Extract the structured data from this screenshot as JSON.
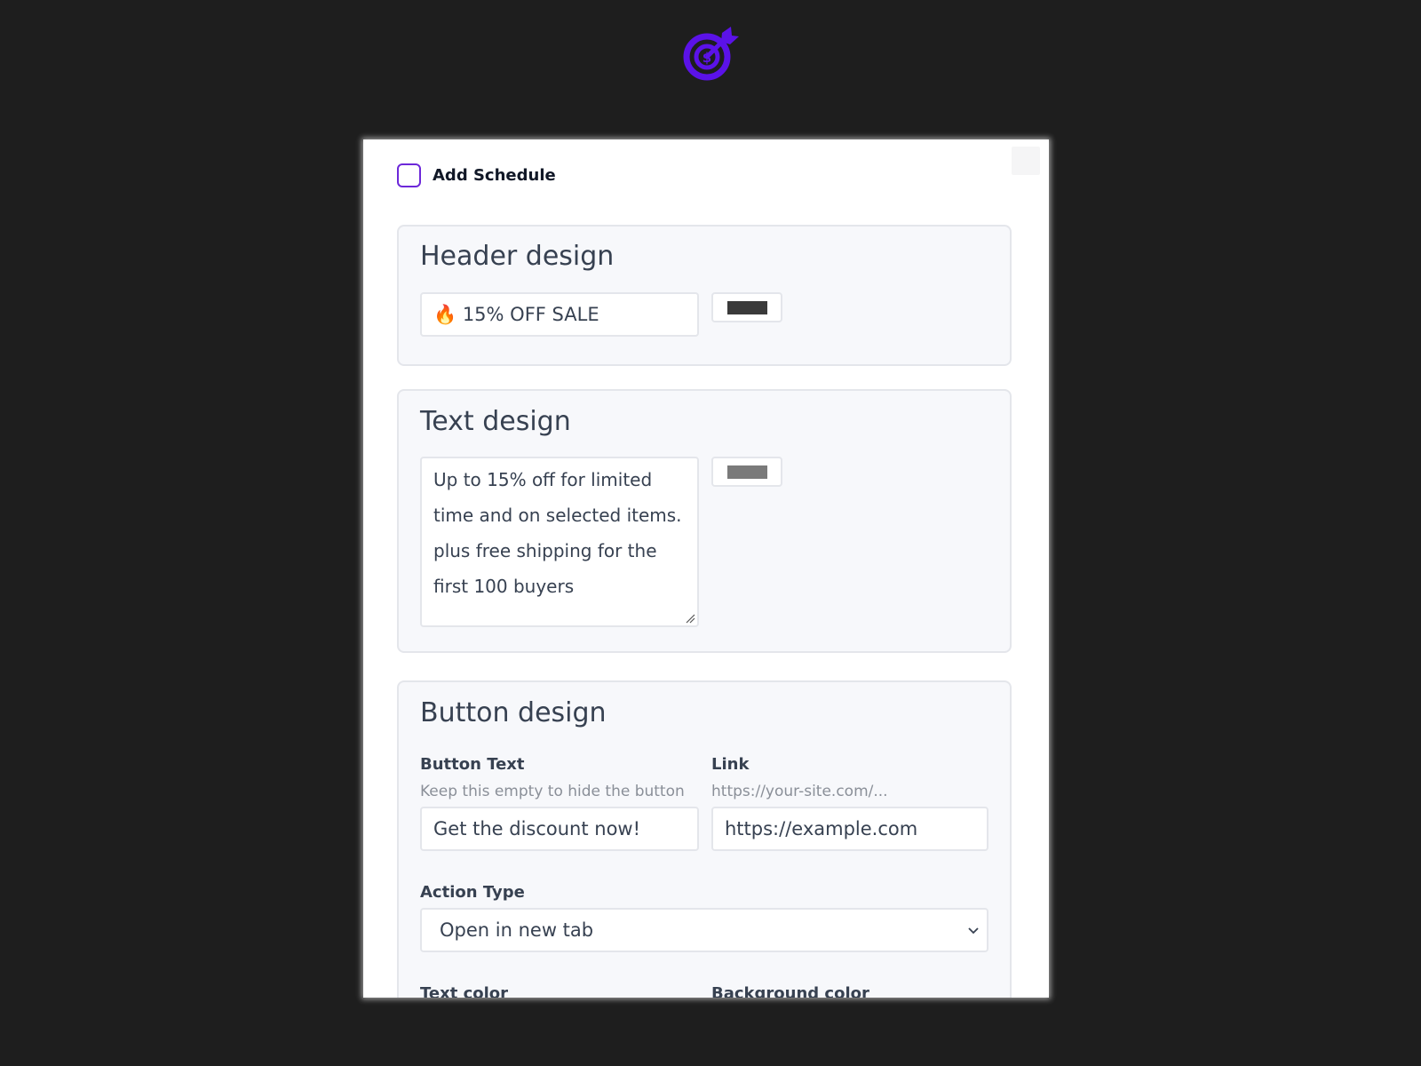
{
  "app": {
    "logo_icon": "target-logo-icon",
    "brand_color": "#5b12e8"
  },
  "schedule": {
    "label": "Add Schedule",
    "checked": false
  },
  "header_design": {
    "title": "Header design",
    "header_value": "🔥 15% OFF SALE",
    "color": "#3a3a3a"
  },
  "text_design": {
    "title": "Text design",
    "text_value": "Up to 15% off for limited time and on selected items. plus free shipping for the first 100 buyers",
    "color": "#7a7a7a"
  },
  "button_design": {
    "title": "Button design",
    "button_text_label": "Button Text",
    "button_text_hint": "Keep this empty to hide the button",
    "button_text_value": "Get the discount now!",
    "link_label": "Link",
    "link_hint": "https://your-site.com/...",
    "link_value": "https://example.com",
    "action_type_label": "Action Type",
    "action_type_value": "Open in new tab",
    "text_color_label": "Text color",
    "background_color_label": "Background color"
  }
}
